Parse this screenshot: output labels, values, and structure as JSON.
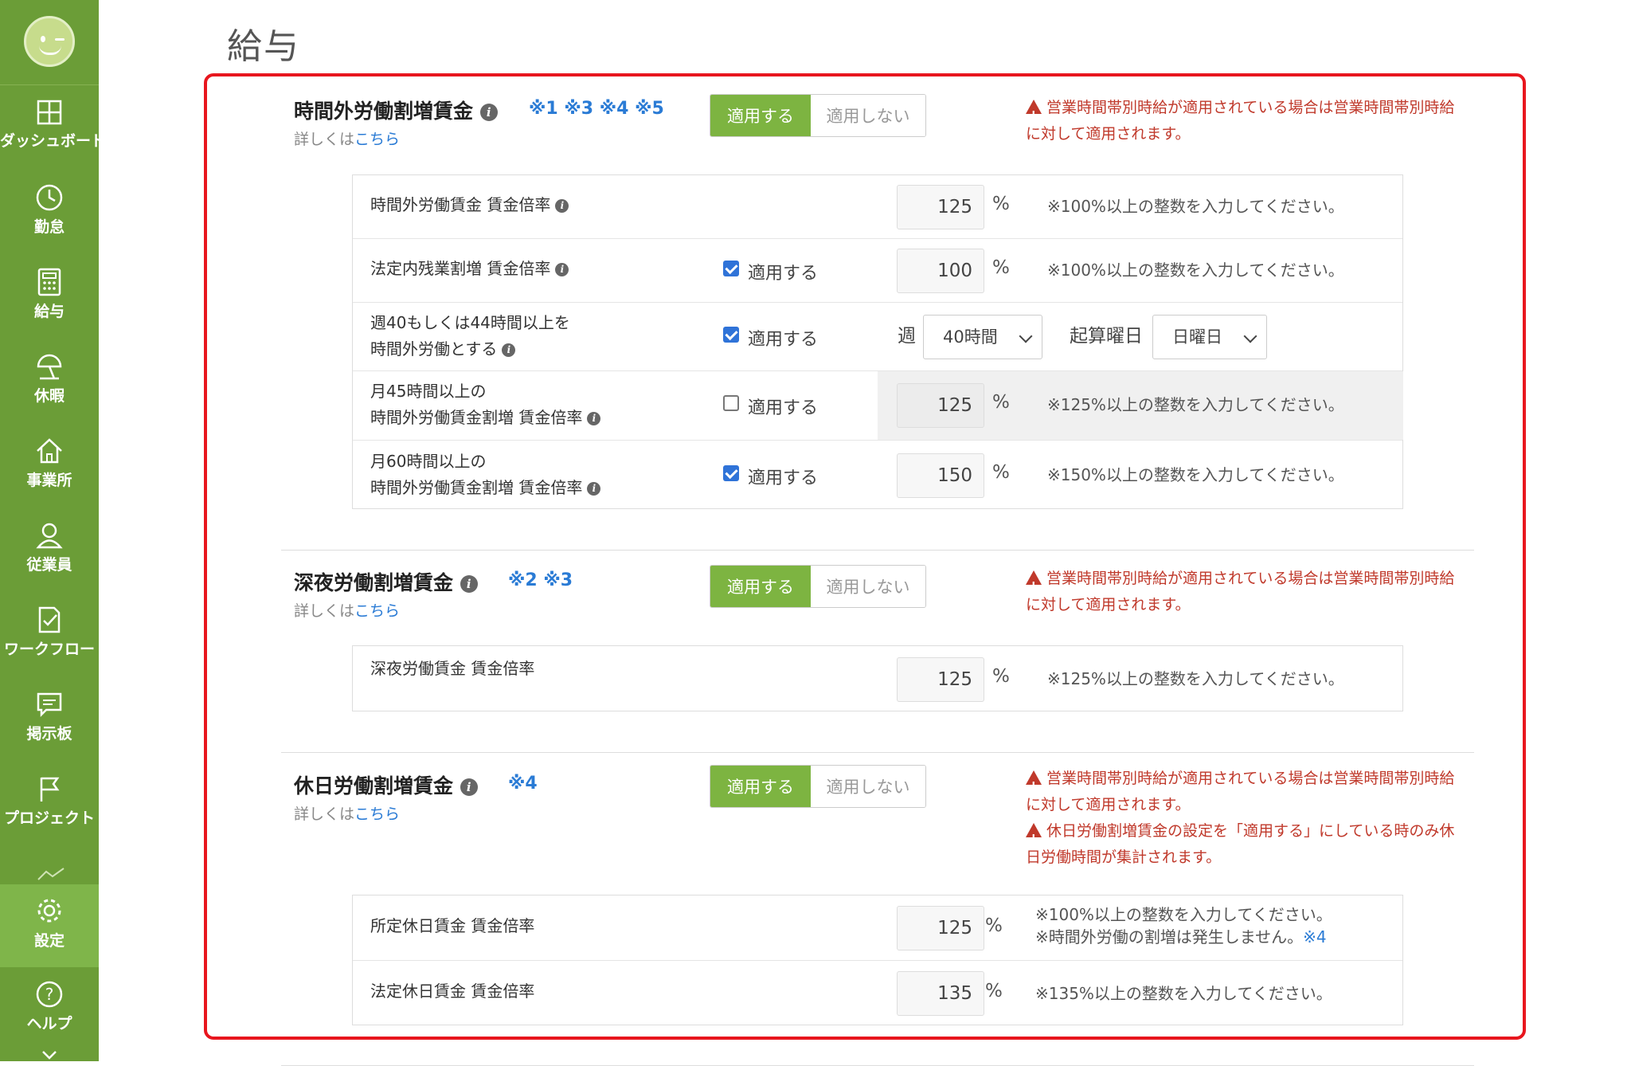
{
  "sidebar": {
    "items": [
      {
        "label": "ダッシュボード",
        "icon": "dashboard-icon"
      },
      {
        "label": "勤怠",
        "icon": "clock-icon"
      },
      {
        "label": "給与",
        "icon": "calculator-icon"
      },
      {
        "label": "休暇",
        "icon": "umbrella-icon"
      },
      {
        "label": "事業所",
        "icon": "home-icon"
      },
      {
        "label": "従業員",
        "icon": "person-icon"
      },
      {
        "label": "ワークフロー",
        "icon": "checklist-icon"
      },
      {
        "label": "掲示板",
        "icon": "message-icon"
      },
      {
        "label": "プロジェクト",
        "icon": "flag-icon"
      },
      {
        "label": "設定",
        "icon": "gear-icon"
      },
      {
        "label": "ヘルプ",
        "icon": "help-icon"
      }
    ],
    "active": "設定",
    "colors": {
      "bg": "#6b9d37",
      "active": "#7fb54a"
    }
  },
  "page": {
    "title": "給与"
  },
  "common": {
    "apply": "適用する",
    "not_apply": "適用しない",
    "detail_prefix": "詳しくは",
    "detail_link": "こちら",
    "percent": "%",
    "warn_hours": "営業時間帯別時給が適用されている場合は営業時間帯別時給に対して適用されます。"
  },
  "overtime": {
    "title": "時間外労働割増賃金",
    "refs": "※1 ※3 ※4 ※5",
    "rows": [
      {
        "label": "時間外労働賃金 賃金倍率",
        "value": "125",
        "hint": "※100%以上の整数を入力してください。"
      },
      {
        "label": "法定内残業割増 賃金倍率",
        "checked": true,
        "value": "100",
        "hint": "※100%以上の整数を入力してください。"
      },
      {
        "label1": "週40もしくは44時間以上を",
        "label2": "時間外労働とする",
        "checked": true,
        "week_label": "週",
        "week_value": "40時間",
        "start_label": "起算曜日",
        "start_value": "日曜日"
      },
      {
        "label1": "月45時間以上の",
        "label2": "時間外労働賃金割増 賃金倍率",
        "checked": false,
        "value": "125",
        "hint": "※125%以上の整数を入力してください。"
      },
      {
        "label1": "月60時間以上の",
        "label2": "時間外労働賃金割増 賃金倍率",
        "checked": true,
        "value": "150",
        "hint": "※150%以上の整数を入力してください。"
      }
    ]
  },
  "night": {
    "title": "深夜労働割増賃金",
    "refs": "※2 ※3",
    "rows": [
      {
        "label": "深夜労働賃金 賃金倍率",
        "value": "125",
        "hint": "※125%以上の整数を入力してください。"
      }
    ]
  },
  "holiday": {
    "title": "休日労働割増賃金",
    "refs": "※4",
    "warn2": "休日労働割増賃金の設定を「適用する」にしている時のみ休日労働時間が集計されます。",
    "rows": [
      {
        "label": "所定休日賃金 賃金倍率",
        "value": "125",
        "hint1": "※100%以上の整数を入力してください。",
        "hint2": "※時間外労働の割増は発生しません。",
        "hint2_ref": "※4"
      },
      {
        "label": "法定休日賃金 賃金倍率",
        "value": "135",
        "hint": "※135%以上の整数を入力してください。"
      }
    ]
  }
}
